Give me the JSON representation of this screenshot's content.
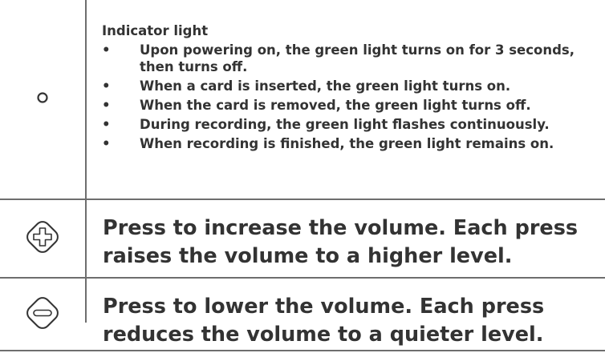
{
  "rows": {
    "indicator": {
      "icon": "indicator-light-icon",
      "title": "Indicator light",
      "bullets": [
        "Upon powering on, the green light turns on for 3 seconds, then turns off.",
        "When a card is inserted, the green light turns on.",
        "When the card is removed, the green light turns off.",
        "During recording, the green light flashes continuously.",
        "When recording is finished, the green light remains on."
      ]
    },
    "volume_up": {
      "icon": "volume-up-plus-icon",
      "text": "Press to increase the volume. Each press raises the volume to a higher level."
    },
    "volume_down": {
      "icon": "volume-down-minus-icon",
      "text": "Press to lower the volume. Each press reduces the volume to a quieter level."
    }
  },
  "bullet_glyph": "•"
}
